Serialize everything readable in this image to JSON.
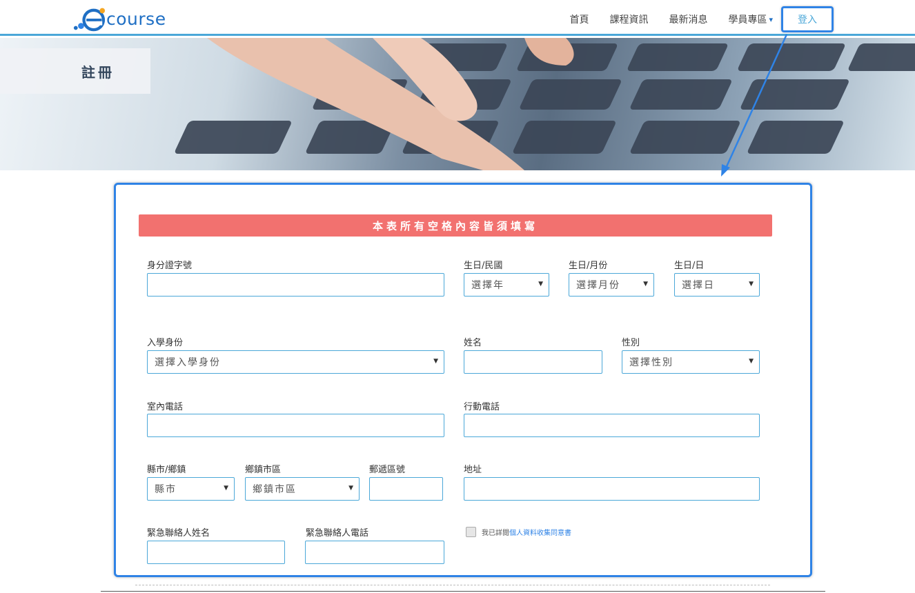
{
  "brand": {
    "logo_letter": "e",
    "logo_text": "course"
  },
  "nav": {
    "items": [
      "首頁",
      "課程資訊",
      "最新消息",
      "學員專區"
    ],
    "dropdown_caret": "▾",
    "login_label": "登入"
  },
  "hero": {
    "title": "註冊"
  },
  "form": {
    "banner": "本表所有空格內容皆須填寫",
    "id_number": {
      "label": "身分證字號",
      "value": ""
    },
    "birth_year": {
      "label": "生日/民國",
      "selected": "選擇年"
    },
    "birth_month": {
      "label": "生日/月份",
      "selected": "選擇月份"
    },
    "birth_day": {
      "label": "生日/日",
      "selected": "選擇日"
    },
    "enroll_status": {
      "label": "入學身份",
      "selected": "選擇入學身份"
    },
    "name": {
      "label": "姓名",
      "value": ""
    },
    "gender": {
      "label": "性別",
      "selected": "選擇性別"
    },
    "home_phone": {
      "label": "室內電話",
      "value": ""
    },
    "mobile_phone": {
      "label": "行動電話",
      "value": ""
    },
    "city": {
      "label": "縣市/鄉鎮",
      "selected": "縣市"
    },
    "district": {
      "label": "鄉鎮市區",
      "selected": "鄉鎮市區"
    },
    "zip": {
      "label": "郵遞區號",
      "value": ""
    },
    "address": {
      "label": "地址",
      "value": ""
    },
    "emergency_name": {
      "label": "緊急聯絡人姓名",
      "value": ""
    },
    "emergency_phone": {
      "label": "緊急聯絡人電話",
      "value": ""
    },
    "consent": {
      "prefix": "我已詳閱",
      "link": "個人資料收集同意書",
      "checked": false
    }
  },
  "colors": {
    "accent": "#2f83e6",
    "banner": "#f2716f",
    "border": "#4aa7d8"
  }
}
